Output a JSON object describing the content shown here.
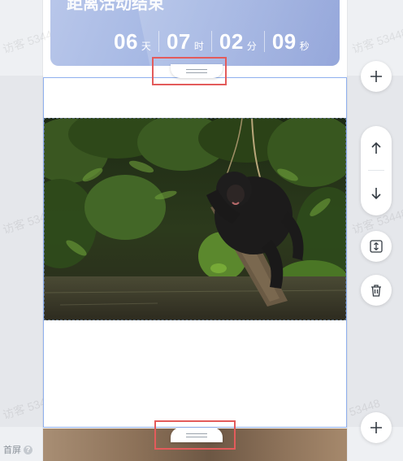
{
  "banner": {
    "title": "距离活动结束",
    "countdown": [
      {
        "value": "06",
        "unit": "天"
      },
      {
        "value": "07",
        "unit": "时"
      },
      {
        "value": "02",
        "unit": "分"
      },
      {
        "value": "09",
        "unit": "秒"
      }
    ]
  },
  "image": {
    "alt": "A bonobo sitting on a log in a jungle stream"
  },
  "watermark": {
    "text": "访客 53448"
  },
  "left_panel": {
    "screen_label": "首屏",
    "help_symbol": "?"
  },
  "toolbar": {
    "add_top_icon": "plus-icon",
    "move_up_icon": "arrow-up-icon",
    "move_down_icon": "arrow-down-icon",
    "resize_icon": "vertical-resize-icon",
    "delete_icon": "trash-icon",
    "add_bottom_icon": "plus-icon"
  },
  "colors": {
    "selection_border": "#8fb0ee",
    "highlight": "#e35b5b",
    "banner_start": "#b9c7ea",
    "banner_end": "#8ea1d8",
    "icon": "#333a42"
  }
}
